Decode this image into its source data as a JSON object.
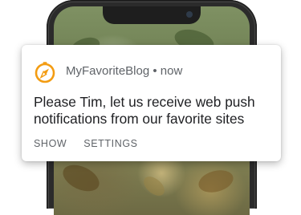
{
  "notification": {
    "app_name": "MyFavoriteBlog",
    "separator": " • ",
    "time": "now",
    "message": "Please Tim, let us receive web push notifications from our favorite sites",
    "actions": [
      {
        "label": "SHOW"
      },
      {
        "label": "SETTINGS"
      }
    ],
    "icon": "compass-icon",
    "accent_color": "#f39c12"
  }
}
